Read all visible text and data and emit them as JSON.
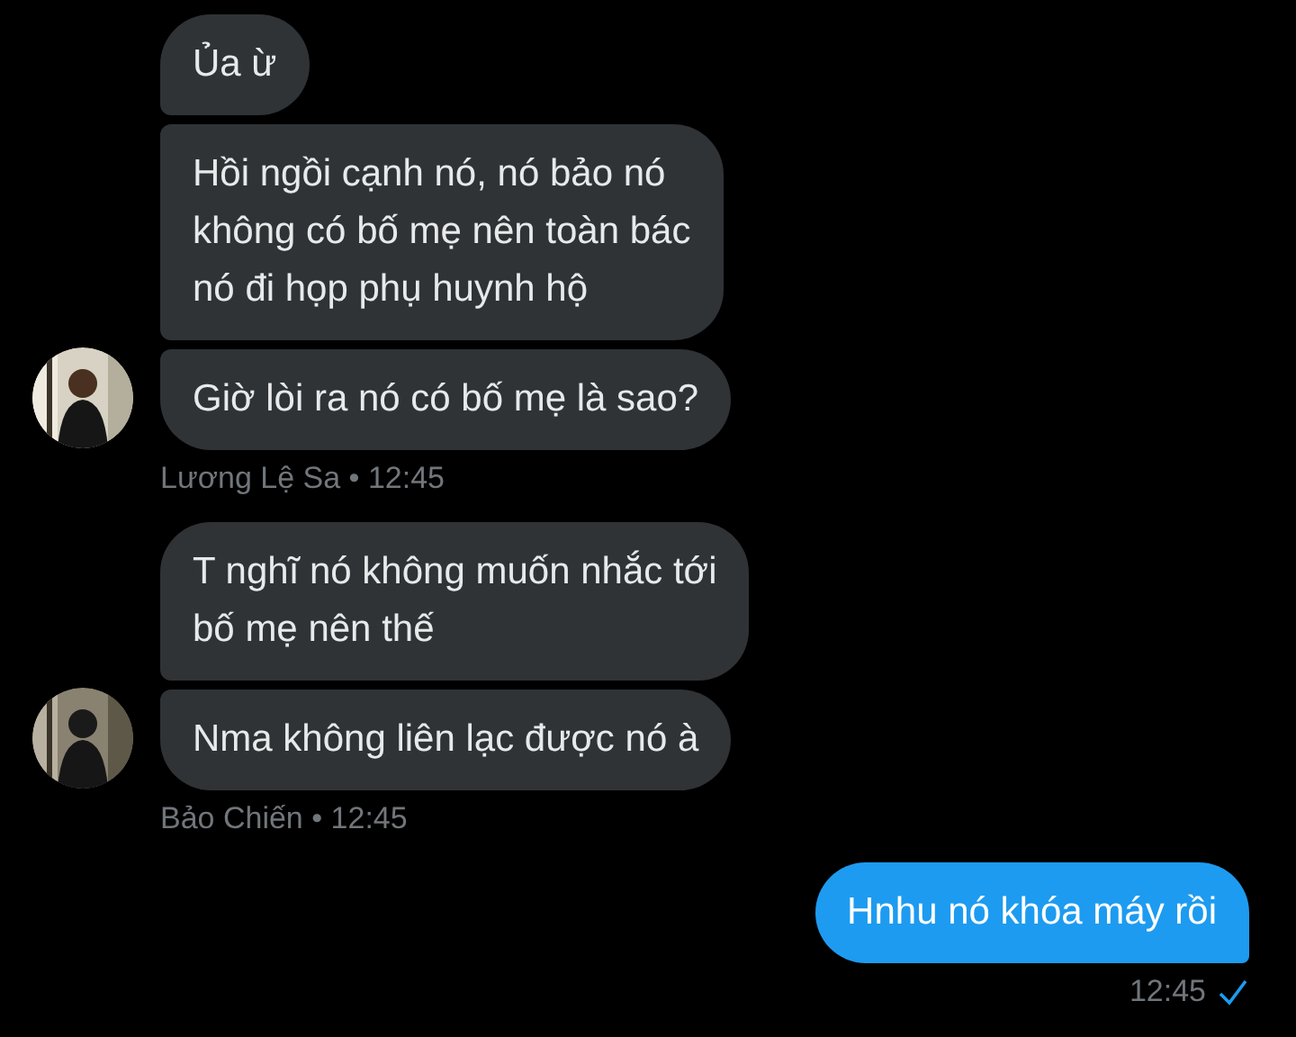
{
  "conversation": [
    {
      "kind": "incoming",
      "meta": "Lương Lệ Sa • 12:45",
      "avatar": {
        "kind": "picture"
      },
      "messages": [
        "Ủa ừ",
        "Hồi ngồi cạnh nó, nó bảo nó\nkhông có bố mẹ nên toàn bác\nnó đi họp phụ huynh hộ",
        "Giờ lòi ra nó có bố mẹ là sao?"
      ]
    },
    {
      "kind": "incoming",
      "meta": "Bảo Chiến • 12:45",
      "avatar": {
        "kind": "picture"
      },
      "messages": [
        "T nghĩ nó không muốn nhắc tới\nbố mẹ nên thế",
        "Nma không liên lạc được nó à"
      ]
    },
    {
      "kind": "outgoing",
      "meta": "12:45",
      "read": true,
      "messages": [
        "Hnhu nó khóa máy rồi"
      ]
    }
  ]
}
